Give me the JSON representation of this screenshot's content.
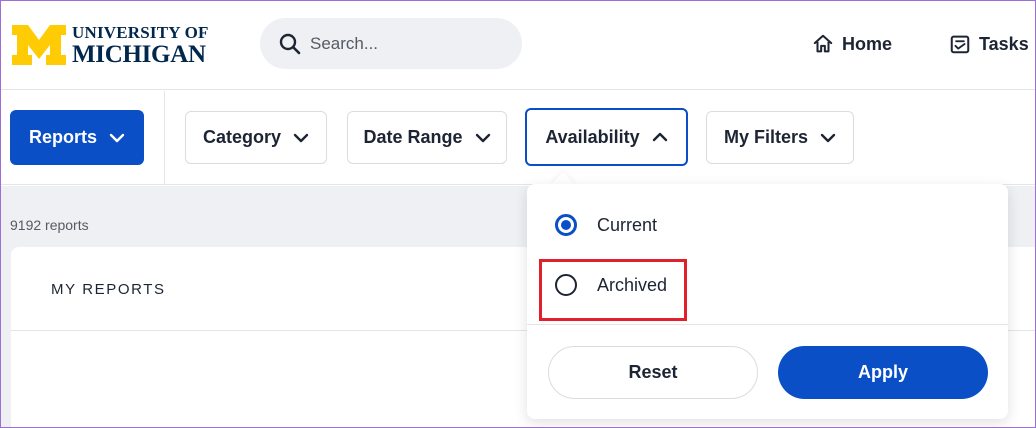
{
  "header": {
    "logo": {
      "line1": "UNIVERSITY OF",
      "line2": "MICHIGAN",
      "maize": "#ffcb05",
      "blue": "#00274c"
    },
    "search": {
      "placeholder": "Search..."
    },
    "nav": [
      {
        "label": "Home",
        "icon": "home-icon"
      },
      {
        "label": "Tasks",
        "icon": "tasks-icon"
      }
    ]
  },
  "filterbar": {
    "reports_label": "Reports",
    "filters": [
      {
        "label": "Category",
        "expanded": false
      },
      {
        "label": "Date Range",
        "expanded": false
      },
      {
        "label": "Availability",
        "expanded": true
      },
      {
        "label": "My Filters",
        "expanded": false
      }
    ]
  },
  "results": {
    "count_text": "9192 reports"
  },
  "card": {
    "title": "MY REPORTS"
  },
  "availability_popover": {
    "options": [
      {
        "label": "Current",
        "checked": true
      },
      {
        "label": "Archived",
        "checked": false
      }
    ],
    "reset_label": "Reset",
    "apply_label": "Apply"
  },
  "colors": {
    "accent": "#0b4fc7",
    "highlight": "#e0202a",
    "text": "#1d2433"
  }
}
